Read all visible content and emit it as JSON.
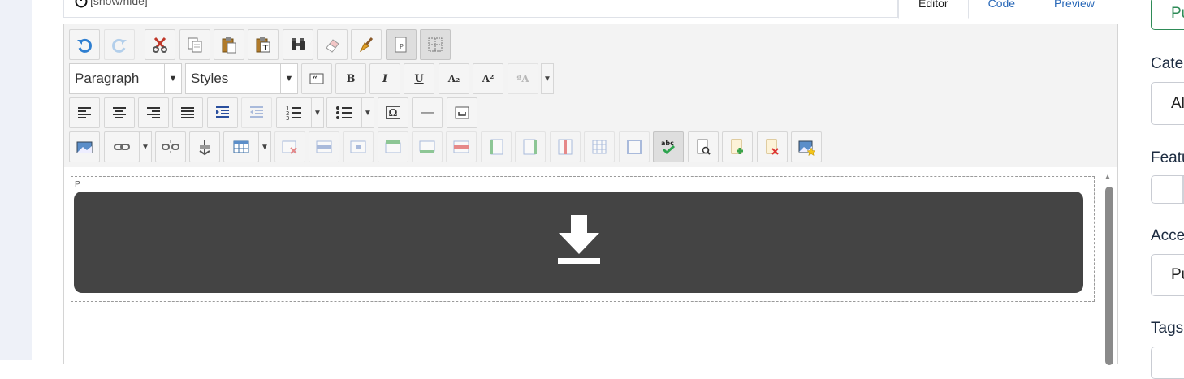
{
  "top": {
    "toggle_text": "[show/hide]"
  },
  "tabs": [
    {
      "label": "Editor",
      "active": true
    },
    {
      "label": "Code",
      "active": false
    },
    {
      "label": "Preview",
      "active": false
    }
  ],
  "toolbar": {
    "row1": [
      "undo-icon",
      "redo-icon",
      "cut-icon",
      "copy-icon",
      "paste-icon",
      "paste-text-icon",
      "find-icon",
      "eraser-icon",
      "cleanup-brush-icon",
      "page-break-icon",
      "visual-aid-grid-icon"
    ],
    "format_select": "Paragraph",
    "styles_select": "Styles",
    "row2_glyphs": {
      "bold": "B",
      "italic": "I",
      "underline": "U",
      "subscript": "A₂",
      "superscript": "A²",
      "textcase": "ªA"
    },
    "omega": "Ω",
    "hr": "—"
  },
  "content": {
    "tag": "P",
    "download_icon": "download-icon"
  },
  "right_panel": {
    "status_value": "Pu",
    "category_label": "Cate",
    "category_value": "Al",
    "featured_label": "Featu",
    "access_label": "Acce",
    "access_value": "Pu",
    "tags_label": "Tags"
  },
  "colors": {
    "accent_link": "#2a69b8",
    "download_bar": "#444444",
    "toolbar_bg": "#f3f3f3"
  }
}
